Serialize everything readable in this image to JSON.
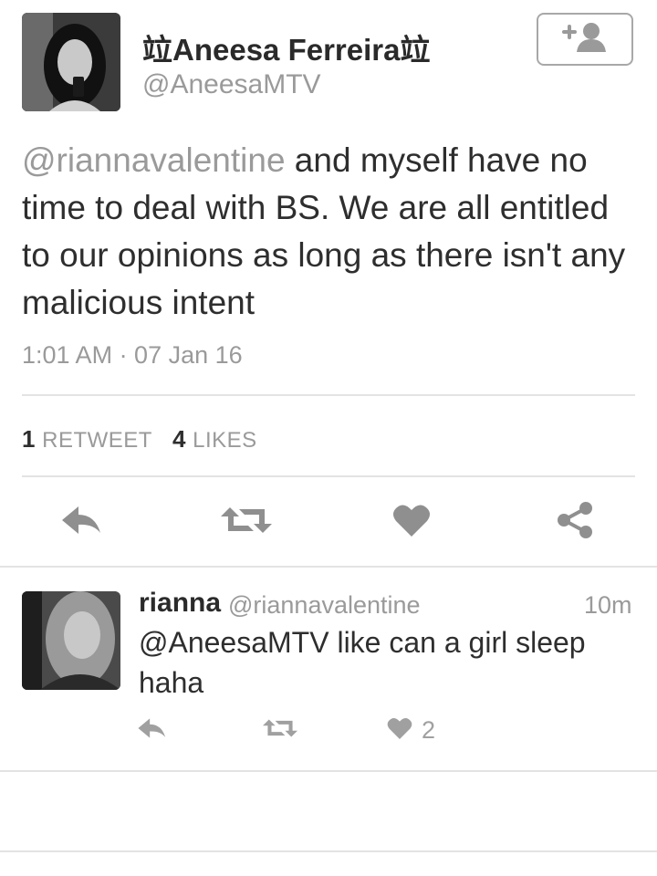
{
  "tweet": {
    "display_name": "竝Aneesa Ferreira竝",
    "handle": "@AneesaMTV",
    "text_mention": "@riannavalentine",
    "text_body": " and myself have no time to deal with BS. We are all entitled to our opinions as long as there isn't any malicious intent",
    "timestamp": "1:01 AM · 07 Jan 16",
    "retweet_count": "1",
    "retweet_label": "RETWEET",
    "likes_count": "4",
    "likes_label": "LIKES",
    "follow_icon": "add-person-icon"
  },
  "actions": {
    "reply_icon": "reply-icon",
    "retweet_icon": "retweet-icon",
    "like_icon": "heart-icon",
    "share_icon": "share-icon"
  },
  "reply": {
    "name": "rianna",
    "handle": "@riannavalentine",
    "time": "10m",
    "text": "@AneesaMTV like can a girl sleep haha",
    "like_count": "2"
  },
  "colors": {
    "text": "#2e2e2e",
    "secondary": "#9a9a9a",
    "icon": "#8f8f8f",
    "divider": "#e3e3e3"
  }
}
